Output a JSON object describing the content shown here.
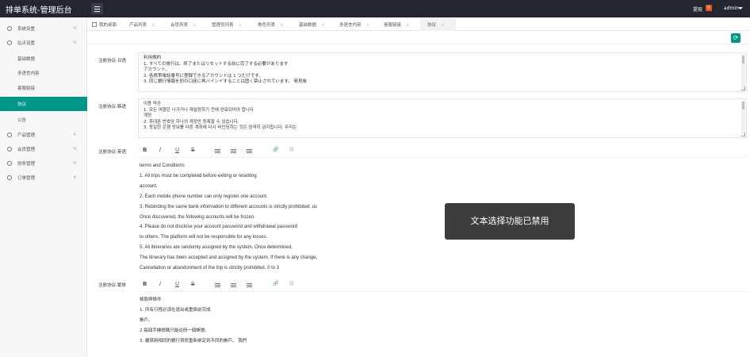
{
  "app": {
    "title": "排单系统-管理后台"
  },
  "header": {
    "notice_label": "提现",
    "notice_count": "0",
    "user": "admin"
  },
  "sidebar": {
    "items": [
      {
        "label": "系统设置",
        "arrow": "<"
      },
      {
        "label": "站点设置",
        "arrow": "<"
      },
      {
        "label": "基础数据"
      },
      {
        "label": "多语言内容"
      },
      {
        "label": "客服链接"
      },
      {
        "label": "协议"
      },
      {
        "label": "公告"
      },
      {
        "label": "产品管理",
        "arrow": "<"
      },
      {
        "label": "会员管理",
        "arrow": "<"
      },
      {
        "label": "财务管理",
        "arrow": "<"
      },
      {
        "label": "订单管理",
        "arrow": "<"
      }
    ]
  },
  "tabs": [
    {
      "label": "我的桌面"
    },
    {
      "label": "产品列表"
    },
    {
      "label": "会员列表"
    },
    {
      "label": "管理员列表"
    },
    {
      "label": "角色列表"
    },
    {
      "label": "基础数据"
    },
    {
      "label": "多语言内容"
    },
    {
      "label": "客服链接"
    },
    {
      "label": "协议"
    }
  ],
  "tab_close": "×",
  "refresh_icon": "⟳",
  "form": {
    "jp": {
      "label": "注册协议-日语",
      "lines": [
        "利用規約",
        "1. すべての旅行は、終了またはリセットする前に完了する必要があります",
        "アカウント。",
        "2. 各携帯電話番号に登録できるアカウントは 1 つだけです。",
        "3. 同じ銀行情報を別の口座に再バインドすることは固く禁止されています。 発見後"
      ]
    },
    "kr": {
      "label": "注册协议-韩语",
      "lines": [
        "이용 약관",
        "1. 모든 여행은 나가거나 재설정하기 전에 완료되어야 합니다",
        "계정",
        "2. 휴대폰 번호당 하나의 계정만 등록할 수 있습니다.",
        "3. 동일한 은행 정보를 다른 계좌에 다시 바인딩하는 것은 엄격히 금지됩니다. 우리는"
      ]
    },
    "en": {
      "label": "注册协议-英语",
      "lines": [
        "terms and Conditions",
        "1. All trips must be completed before exiting or resetting",
        "account.",
        "2. Each mobile phone number can only register one account.",
        "3. Rebinding the same bank information to different accounts is strictly prohibited. us",
        "Once discovered, the following accounts will be frozen.",
        "4. Please do not disclose your account password and withdrawal password",
        "to others. The platform will not be responsible for any losses.",
        "5. All itineraries are randomly assigned by the system. Once determined,",
        "The itinerary has been accepted and assigned by the system. If there is any change,",
        "Cancellation or abandonment of the trip is strictly prohibited. 0 to 3"
      ]
    },
    "tw": {
      "label": "注册协议-繁体",
      "lines": [
        "條款與條件",
        "1. 所有行程必須在退出或重設前完成",
        "帳戶。",
        "2.每個手機號碼只能註冊一個帳號。",
        "3. 嚴禁將相同的銀行資訊重新綁定到不同的帳戶。 我們"
      ]
    }
  },
  "editor_tools": {
    "bold": "B",
    "italic": "I",
    "underline": "U",
    "strike": "S",
    "link": "🔗",
    "unlink": "⛓"
  },
  "toast": "文本选择功能已禁用"
}
